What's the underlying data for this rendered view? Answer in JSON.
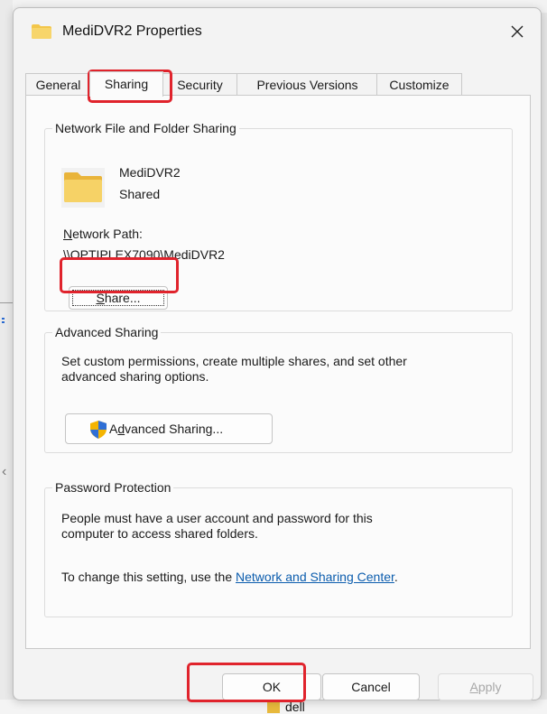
{
  "window": {
    "title": "MediDVR2 Properties",
    "close_glyph": "×"
  },
  "tabs": [
    {
      "label": "General"
    },
    {
      "label": "Sharing",
      "active": true
    },
    {
      "label": "Security"
    },
    {
      "label": "Previous Versions"
    },
    {
      "label": "Customize"
    }
  ],
  "network_sharing": {
    "group_title": "Network File and Folder Sharing",
    "folder_name": "MediDVR2",
    "folder_status": "Shared",
    "network_path_label": "Network Path:",
    "network_path": "\\\\OPTIPLEX7090\\MediDVR2",
    "share_button": "Share..."
  },
  "advanced_sharing": {
    "group_title": "Advanced Sharing",
    "description_line1": "Set custom permissions, create multiple shares, and set other",
    "description_line2": "advanced sharing options.",
    "button": "Advanced Sharing..."
  },
  "password_protection": {
    "group_title": "Password Protection",
    "description_line1": "People must have a user account and password for this",
    "description_line2": "computer to access shared folders.",
    "change_text": "To change this setting, use the ",
    "link": "Network and Sharing Center",
    "period": "."
  },
  "footer": {
    "ok": "OK",
    "cancel": "Cancel",
    "apply": "Apply"
  },
  "background": {
    "taskbar_folder_label": "dell"
  },
  "colors": {
    "highlight": "#e0232c",
    "folder": "#f3c64a",
    "link": "#0b5cad"
  },
  "icons": {
    "title": "folder-icon",
    "close": "close-icon",
    "folder": "folder-icon",
    "uac": "shield-icon"
  }
}
